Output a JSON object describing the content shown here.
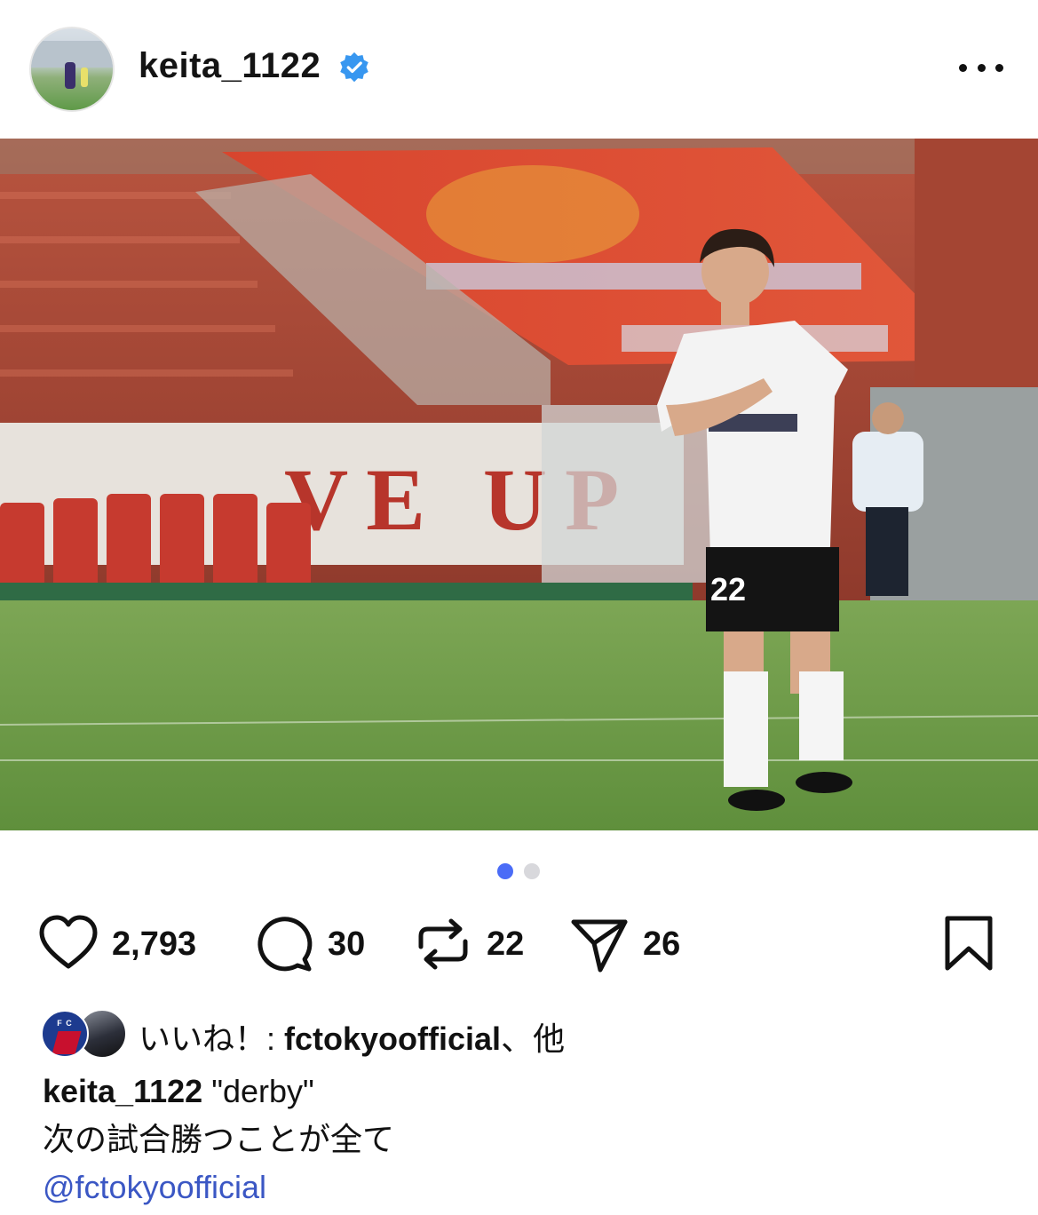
{
  "header": {
    "username": "keita_1122",
    "verified": true,
    "more_icon": "more-horizontal-icon"
  },
  "post": {
    "image_alt": "",
    "carousel": {
      "current": 1,
      "total": 2
    }
  },
  "actions": {
    "like_count": "2,793",
    "comment_count": "30",
    "repost_count": "22",
    "share_count": "26"
  },
  "likes_line": {
    "prefix": "いいね！: ",
    "user": "fctokyoofficial",
    "suffix": "、他"
  },
  "caption": {
    "username": "keita_1122",
    "title": " \"derby\"",
    "line2": "次の試合勝つことが全て",
    "mention": "@fctokyoofficial"
  },
  "colors": {
    "accent": "#3b57c4",
    "verified_badge": "#3897f0",
    "dot_active": "#4a6cf7",
    "dot_inactive": "#d8d8dc"
  }
}
